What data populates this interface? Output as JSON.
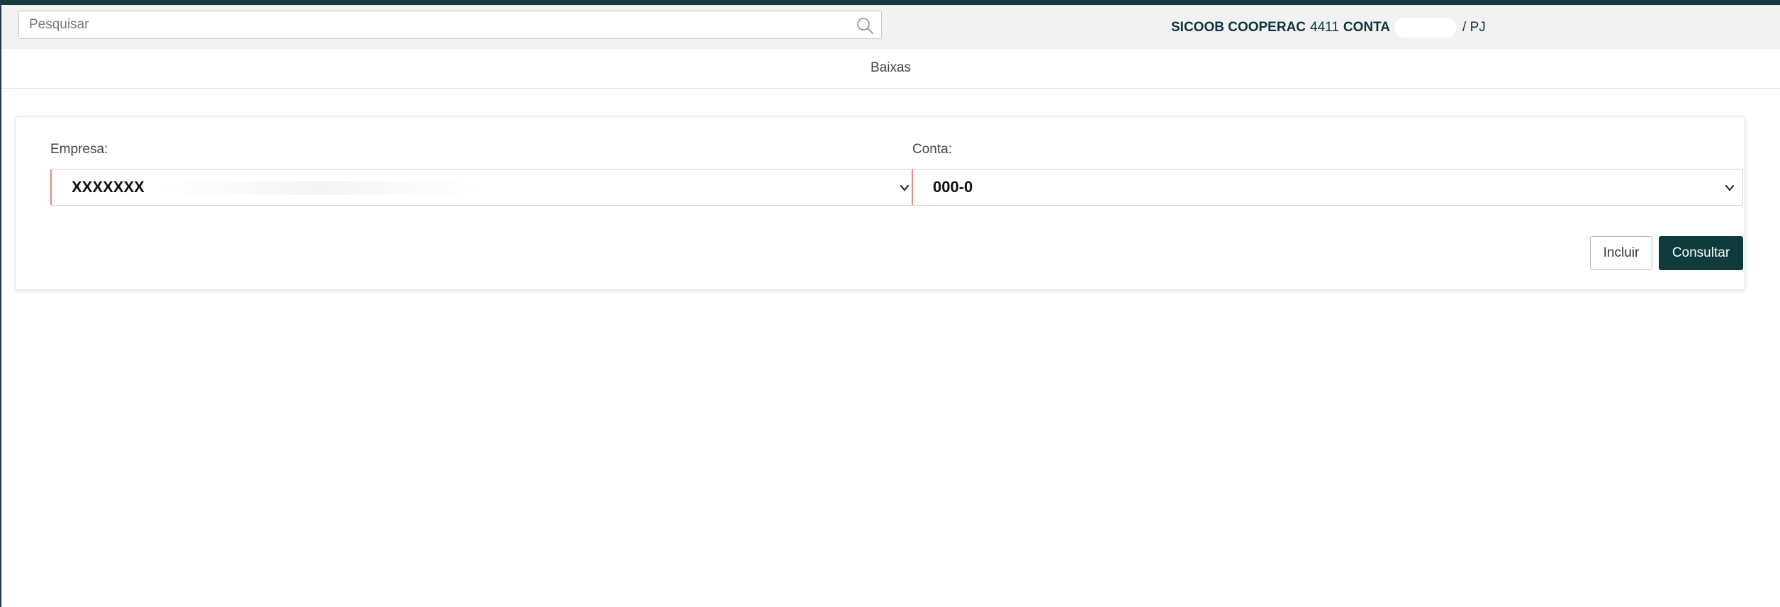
{
  "header": {
    "search_placeholder": "Pesquisar",
    "account": {
      "bank": "SICOOB COOPERAC",
      "agency": "4411",
      "conta_label": "CONTA",
      "suffix": "/ PJ"
    }
  },
  "page": {
    "title": "Baixas"
  },
  "form": {
    "empresa": {
      "label": "Empresa:",
      "value": "XXXXXXX"
    },
    "conta": {
      "label": "Conta:",
      "value": "000-0"
    },
    "buttons": {
      "incluir": "Incluir",
      "consultar": "Consultar"
    }
  },
  "icons": {
    "search": "search-icon",
    "dropdown": "chevron-down-icon"
  },
  "colors": {
    "top_strip": "#173a3e",
    "primary_button": "#0f3b3c",
    "account_text": "#0d3440",
    "select_accent": "#e08a86"
  }
}
